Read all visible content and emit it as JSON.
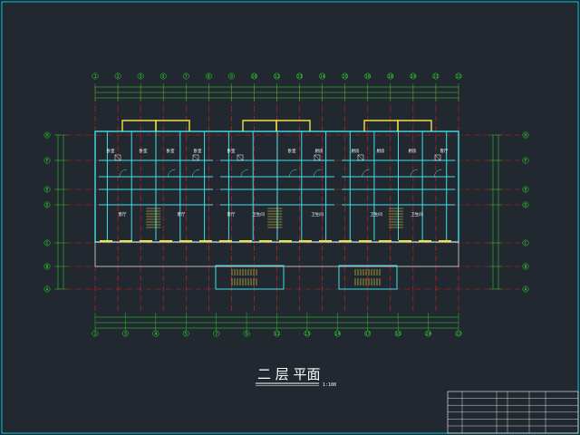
{
  "drawing": {
    "title": "二 层 平面",
    "scale": "1:100",
    "colors": {
      "background": "#212830",
      "border": "#00c8d8",
      "axis": "#e02020",
      "dimension": "#2fe02f",
      "wall": "#40e0e8",
      "window": "#f0e040",
      "text": "#ffffff"
    },
    "top_axes": [
      "1",
      "2",
      "3",
      "5",
      "7",
      "8",
      "9",
      "10",
      "11",
      "13",
      "14",
      "15",
      "16",
      "18",
      "19",
      "21",
      "22"
    ],
    "bottom_axes": [
      "1",
      "3",
      "4",
      "5",
      "7",
      "9",
      "11",
      "13",
      "14",
      "17",
      "18",
      "20",
      "22"
    ],
    "left_axes": [
      "H",
      "F",
      "E",
      "D",
      "C",
      "B",
      "A"
    ],
    "right_axes": [
      "H",
      "F",
      "E",
      "D",
      "C",
      "B",
      "A"
    ],
    "rooms": [
      {
        "label": "卧室",
        "icon": "bedroom"
      },
      {
        "label": "卧室",
        "icon": "bedroom"
      },
      {
        "label": "卧室",
        "icon": "bedroom"
      },
      {
        "label": "卧室",
        "icon": "bedroom"
      },
      {
        "label": "卧室",
        "icon": "bedroom"
      },
      {
        "label": "卧室",
        "icon": "bedroom"
      },
      {
        "label": "厨房",
        "icon": "kitchen"
      },
      {
        "label": "厨房",
        "icon": "kitchen"
      },
      {
        "label": "厨房",
        "icon": "kitchen"
      },
      {
        "label": "厨房",
        "icon": "kitchen"
      },
      {
        "label": "客厅",
        "icon": "living"
      },
      {
        "label": "客厅",
        "icon": "living"
      },
      {
        "label": "客厅",
        "icon": "living"
      },
      {
        "label": "客厅",
        "icon": "living"
      },
      {
        "label": "卫生间",
        "icon": "toilet"
      },
      {
        "label": "卫生间",
        "icon": "toilet"
      },
      {
        "label": "卫生间",
        "icon": "toilet"
      },
      {
        "label": "卫生间",
        "icon": "toilet"
      }
    ],
    "title_block": {
      "rows": [
        "",
        "",
        "",
        "",
        "",
        ""
      ]
    }
  }
}
